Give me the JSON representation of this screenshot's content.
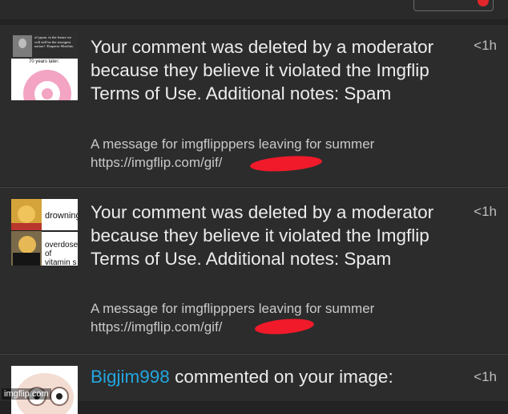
{
  "notifications": [
    {
      "message": "Your comment was deleted by a moderator because they believe it violated the Imgflip Terms of Use. Additional notes: Spam",
      "sub_line1": "A message for imgflipppers leaving for summer",
      "sub_line2": "https://imgflip.com/gif/",
      "time": "<1h",
      "thumb_text": "of japan. in the future we will still be the strongest nation! -Emperor Hirohito",
      "thumb_caption": "70 years later:"
    },
    {
      "message": "Your comment was deleted by a moderator because they believe it violated the Imgflip Terms of Use. Additional notes: Spam",
      "sub_line1": "A message for imgflipppers leaving for summer",
      "sub_line2": "https://imgflip.com/gif/",
      "time": "<1h",
      "thumb_label1": "drowning",
      "thumb_label2": "overdose of vitamin s"
    },
    {
      "username": "Bigjim998",
      "action": " commented on your image:",
      "time": "<1h"
    }
  ],
  "watermark": "imgflip.com",
  "colors": {
    "background": "#232323",
    "card": "#2c2c2c",
    "username": "#22a6df",
    "redaction": "#f01a2a",
    "badge": "#e3262b"
  }
}
